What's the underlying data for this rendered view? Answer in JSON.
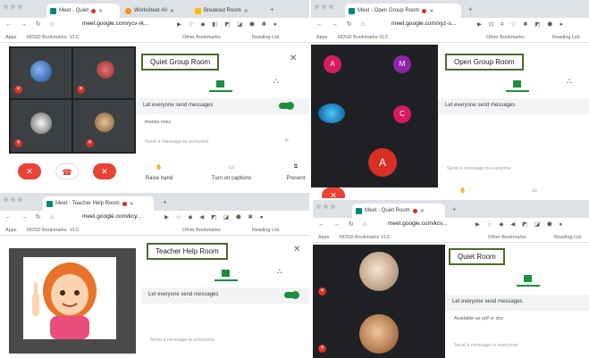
{
  "browser": {
    "bookmarks_bar": {
      "apps": "Apps",
      "rdsd": "RDSD Bookmarks",
      "vlc": "VLC",
      "other": "Other Bookmarks",
      "reading_list": "Reading List"
    },
    "url_text": "meet.google.com/ycv-rk..."
  },
  "q1": {
    "tabs": [
      "Meet - Quiet",
      "Worksheet #0",
      "Breakout Room"
    ],
    "url": "meet.google.com/ycv-rk...",
    "panel_title": "Quiet Group Room",
    "setting_label": "Let everyone send messages",
    "message": "thanks miss",
    "input_placeholder": "Send a message to everyone",
    "controls": {
      "raise_hand": "Raise hand",
      "captions": "Turn on captions",
      "present": "Present"
    }
  },
  "q2": {
    "tab": "Meet - Open Group Room",
    "url": "meet.google.com/xyz-s...",
    "panel_title": "Open Group Room",
    "setting_label": "Let everyone send messages",
    "input_placeholder": "Send a message to everyone",
    "participants": [
      {
        "letter": "A",
        "color": "#d81b60"
      },
      {
        "letter": "M",
        "color": "#8e24aa"
      },
      {
        "letter": "C",
        "color": "#d81b60"
      },
      {
        "letter": "A",
        "color": "#d93025"
      }
    ]
  },
  "q3": {
    "tab": "Meet - Teacher Help Room",
    "url": "meet.google.com/kcy...",
    "panel_title": "Teacher Help Room",
    "setting_label": "Let everyone send messages",
    "input_placeholder": "Send a message to everyone"
  },
  "q4": {
    "tab": "Meet - Quiet Room",
    "url": "meet.google.com/kcv...",
    "panel_title": "Quiet Room",
    "setting_label": "Let everyone send messages",
    "message": "Available as pdf or doc",
    "input_placeholder": "Send a message to everyone"
  },
  "colors": {
    "accent": "#1e8e3e",
    "mute_red": "#d93025",
    "title_border": "#4a6b2a"
  }
}
